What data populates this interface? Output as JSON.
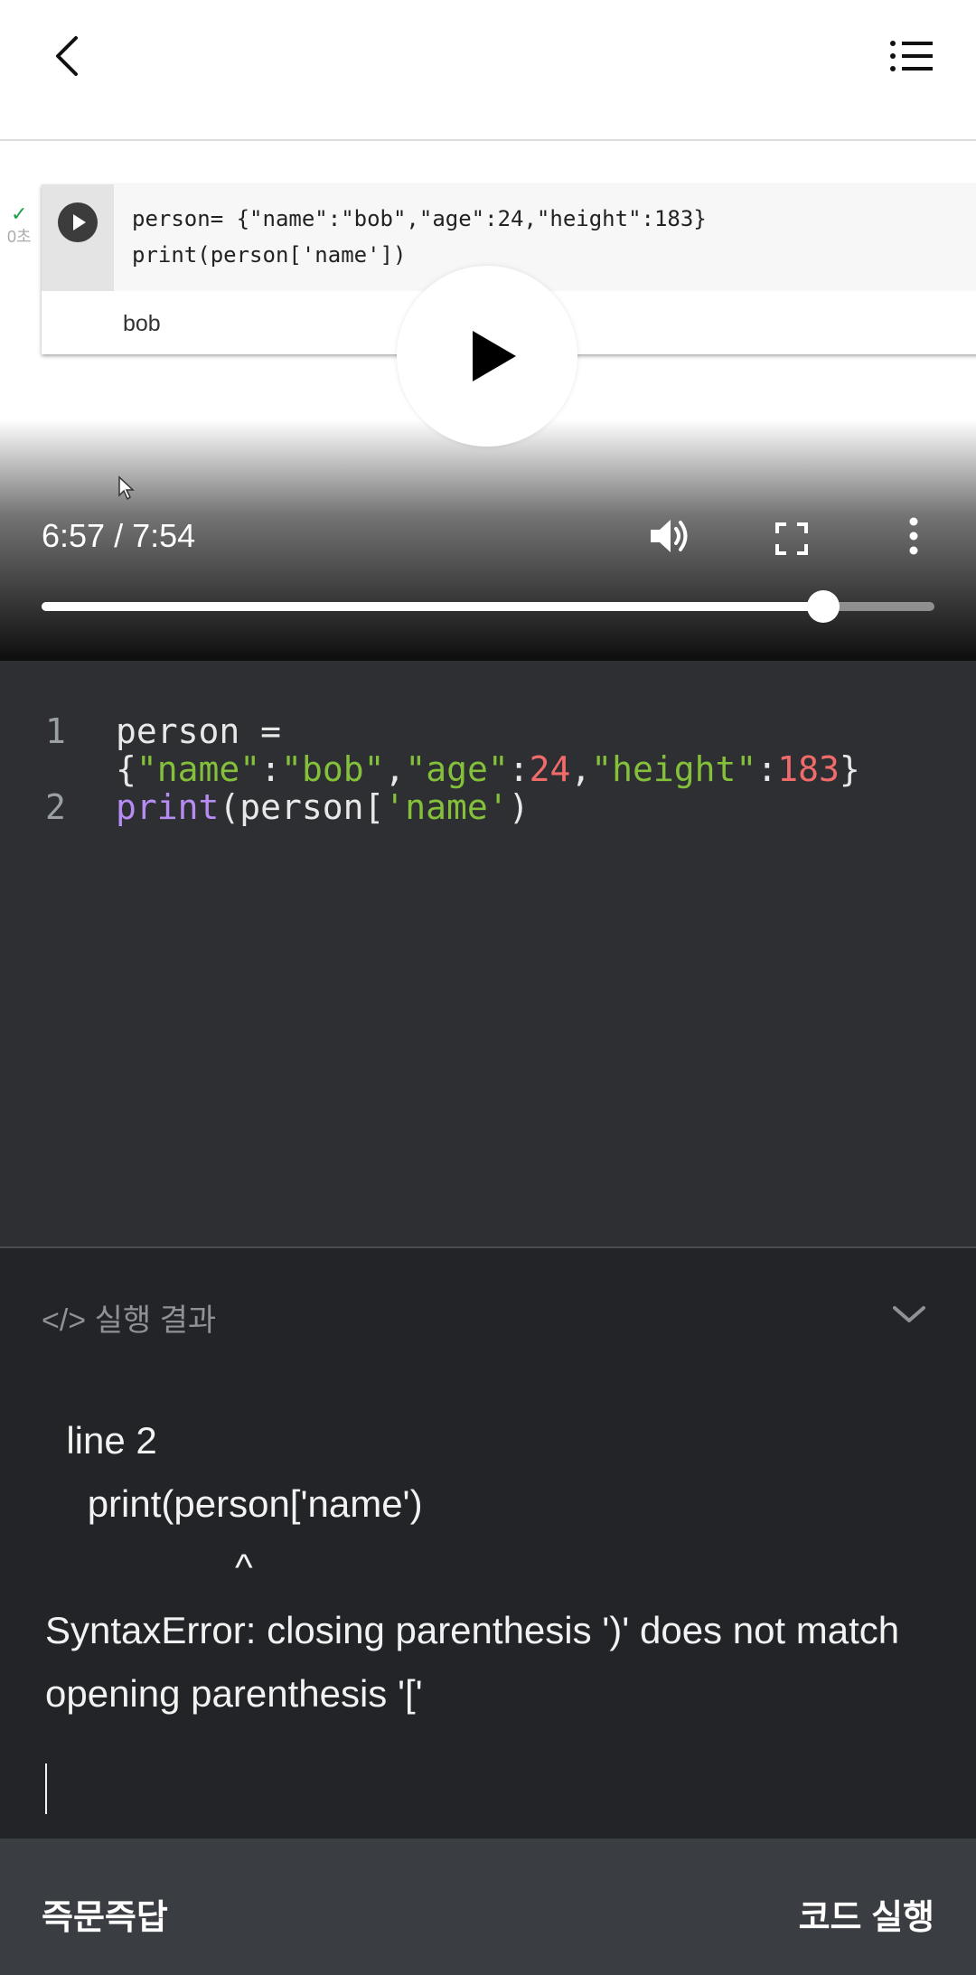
{
  "video": {
    "cell_code_line1": "person= {\"name\":\"bob\",\"age\":24,\"height\":183}",
    "cell_code_line2": "print(person['name'])",
    "cell_output": "bob",
    "cell_time": "0초",
    "time_display": "6:57 / 7:54",
    "progress_fraction": 0.876
  },
  "editor": {
    "line_numbers": [
      "1",
      "2"
    ],
    "line1a": "person =",
    "line1b_open": "{",
    "line1b_k1": "\"name\"",
    "line1b_v1": "\"bob\"",
    "line1b_k2": "\"age\"",
    "line1b_v2": "24",
    "line1b_k3": "\"height\"",
    "line1b_v3": "183",
    "line1b_close": "}",
    "line2_fn": "print",
    "line2_mid": "(person[",
    "line2_str": "'name'",
    "line2_end": ")"
  },
  "result": {
    "title": "</> 실행 결과",
    "output": "  line 2\n    print(person['name')\n                  ^\nSyntaxError: closing parenthesis ')' does not match opening parenthesis '['"
  },
  "bottom": {
    "left_label": "즉문즉답",
    "right_label": "코드 실행"
  },
  "colors": {
    "string": "#84c03a",
    "number": "#f26b6b",
    "keyword": "#b68cf2",
    "panel_bg": "#2d2f33"
  }
}
